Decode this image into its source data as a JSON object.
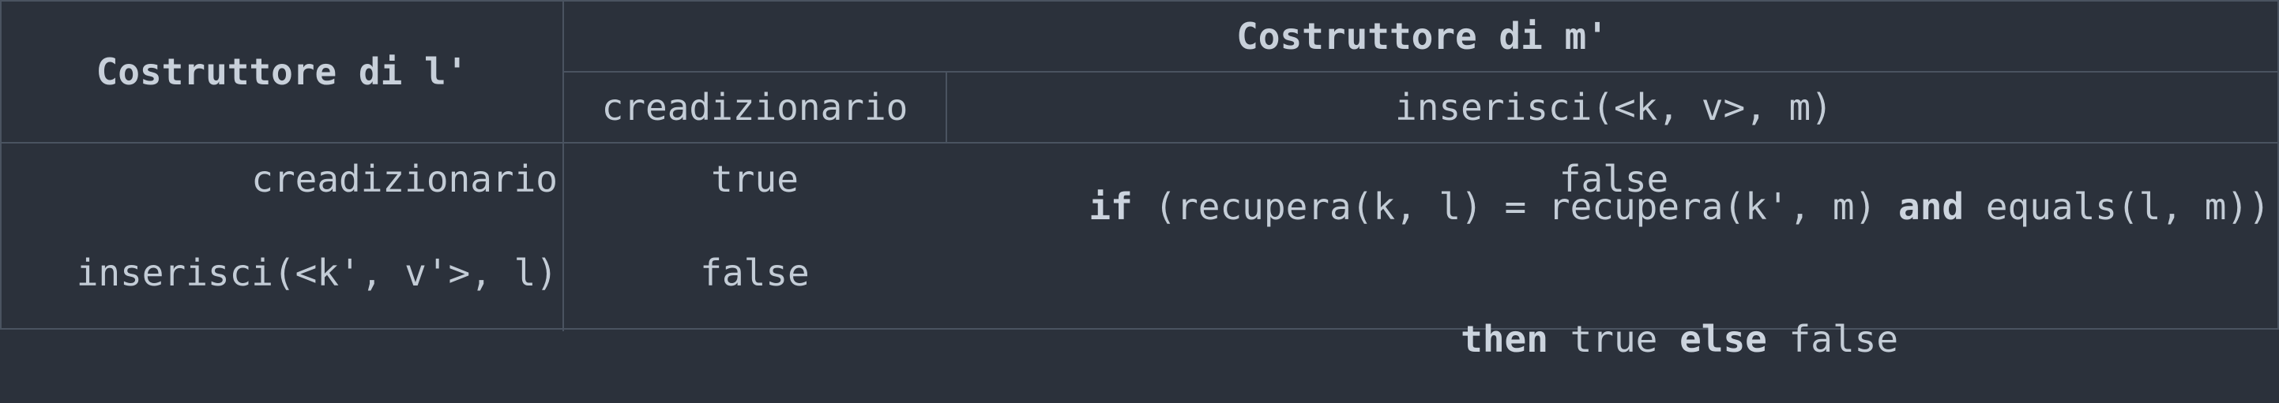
{
  "header": {
    "col1_title": "Costruttore di l'",
    "col_group_title": "Costruttore di m'",
    "sub_col1": "creadizionario",
    "sub_col2": "inserisci(<k, v>, m)"
  },
  "rows": [
    {
      "label": "creadizionario",
      "val1": "true",
      "val2": "false"
    },
    {
      "label": "inserisci(<k', v'>, l)",
      "val1": "false",
      "expr": {
        "if_kw": "if",
        "part1": " (recupera(k, l) = recupera(k', m) ",
        "and_kw": "and",
        "part2": " equals(l, m))",
        "then_kw": "then",
        "then_val": " true ",
        "else_kw": "else",
        "else_val": " false"
      }
    }
  ]
}
